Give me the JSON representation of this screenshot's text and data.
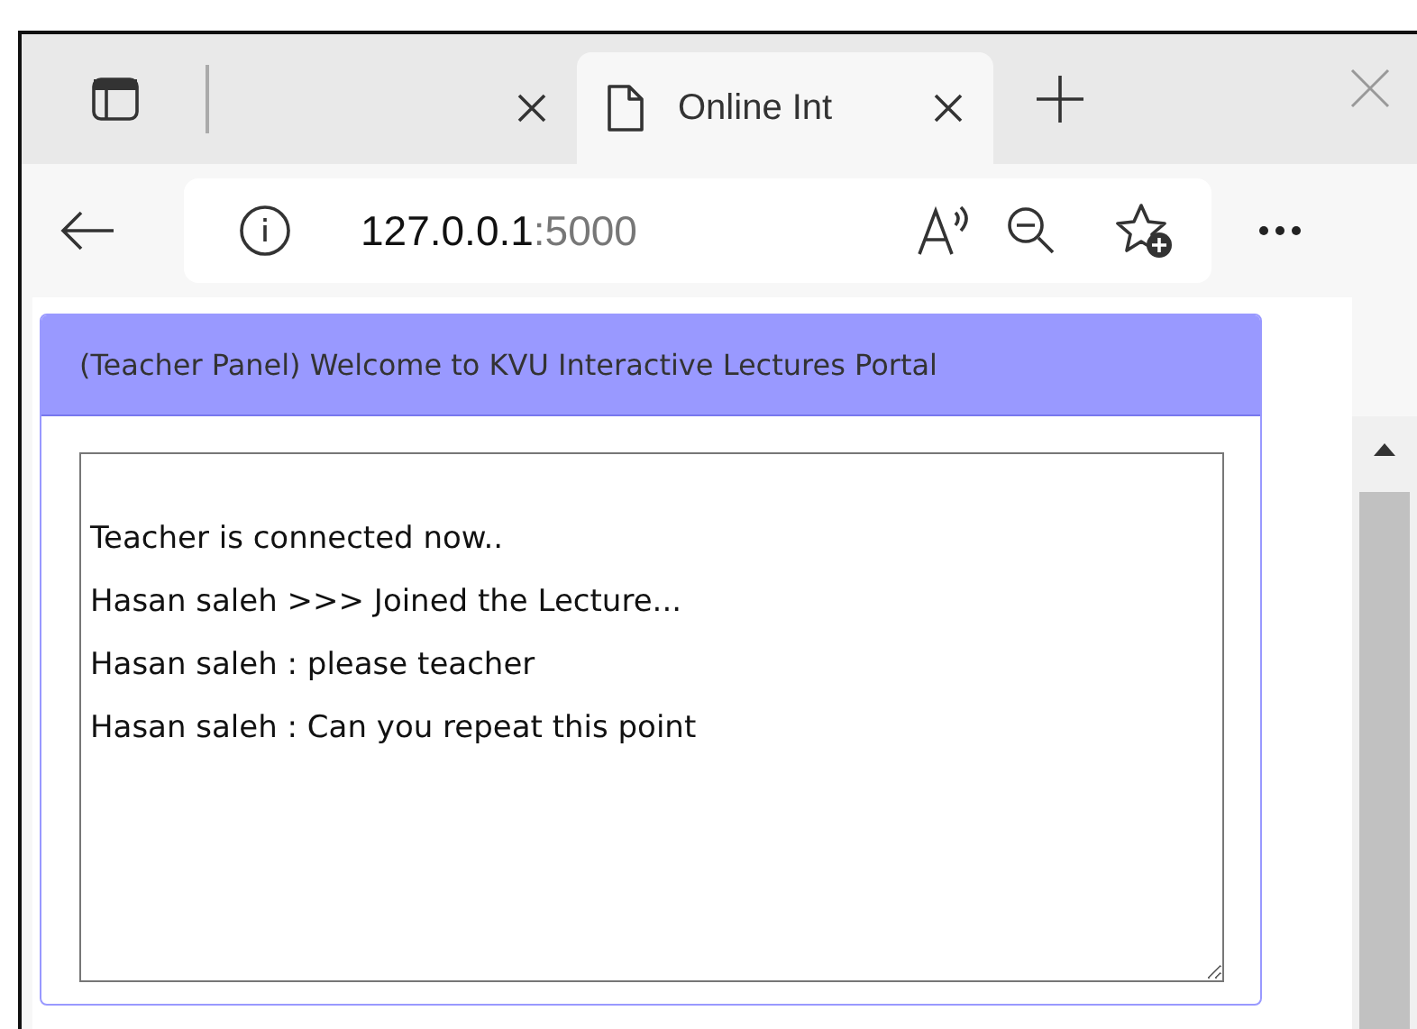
{
  "browser": {
    "tabs": [
      {
        "selected": false
      },
      {
        "title": "Online Int",
        "selected": true
      }
    ],
    "address": {
      "host": "127.0.0.1",
      "port": ":5000"
    }
  },
  "panel": {
    "heading": "(Teacher Panel) Welcome to KVU Interactive Lectures Portal",
    "log": [
      "Teacher is connected now..",
      "Hasan saleh >>> Joined the Lecture...",
      "Hasan saleh : please teacher",
      "Hasan saleh : Can you repeat this point"
    ]
  }
}
